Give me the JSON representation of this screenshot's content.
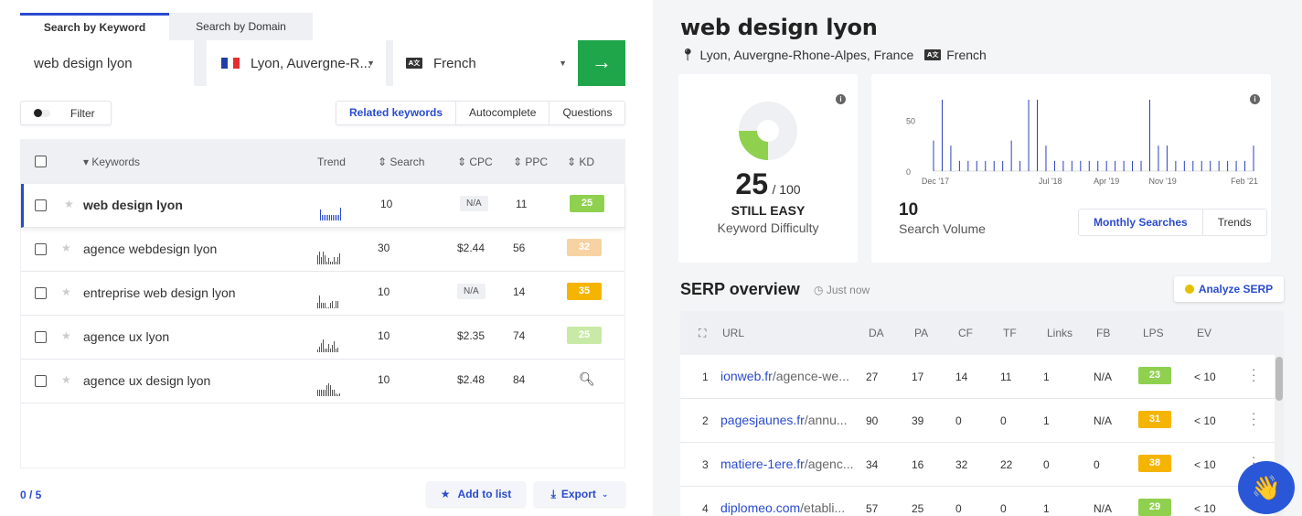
{
  "tabs": [
    {
      "label": "Search by Keyword"
    },
    {
      "label": "Search by Domain"
    }
  ],
  "search": {
    "keyword_value": "web design lyon",
    "location": "Lyon, Auvergne-R...",
    "language": "French",
    "go_icon": "arrow-right-icon"
  },
  "filter_label": "Filter",
  "kw_tabs": [
    {
      "label": "Related keywords"
    },
    {
      "label": "Autocomplete"
    },
    {
      "label": "Questions"
    }
  ],
  "table": {
    "headers": {
      "keywords": "Keywords",
      "trend": "Trend",
      "search": "Search",
      "cpc": "CPC",
      "ppc": "PPC",
      "kd": "KD"
    },
    "rows": [
      {
        "keyword": "web design lyon",
        "search": "10",
        "cpc": "N/A",
        "ppc": "11",
        "kd": "25",
        "kd_color": "#8fd14f"
      },
      {
        "keyword": "agence webdesign lyon",
        "search": "30",
        "cpc": "$2.44",
        "ppc": "56",
        "kd": "32",
        "kd_color": "#f7d3a3"
      },
      {
        "keyword": "entreprise web design lyon",
        "search": "10",
        "cpc": "N/A",
        "ppc": "14",
        "kd": "35",
        "kd_color": "#f5b400"
      },
      {
        "keyword": "agence ux lyon",
        "search": "10",
        "cpc": "$2.35",
        "ppc": "74",
        "kd": "25",
        "kd_color": "#c8eaa6"
      },
      {
        "keyword": "agence ux design lyon",
        "search": "10",
        "cpc": "$2.48",
        "ppc": "84",
        "kd": "",
        "kd_color": ""
      }
    ]
  },
  "footer": {
    "count": "0 / 5",
    "add_to_list": "Add to list",
    "export": "Export"
  },
  "overview": {
    "title": "web design lyon",
    "location": "Lyon, Auvergne-Rhone-Alpes, France",
    "language": "French",
    "kd_score": "25",
    "kd_max": "/ 100",
    "kd_verdict": "STILL EASY",
    "kd_label": "Keyword Difficulty",
    "volume": "10",
    "volume_label": "Search Volume",
    "vol_tabs": [
      {
        "label": "Monthly Searches"
      },
      {
        "label": "Trends"
      }
    ]
  },
  "chart_data": {
    "type": "bar",
    "title": "",
    "categories": [
      "Dec '17",
      "Jul '18",
      "Apr '19",
      "Nov '19",
      "Feb '21"
    ],
    "yticks": [
      "0",
      "50"
    ],
    "ylim": [
      0,
      70
    ],
    "values": [
      30,
      70,
      25,
      10,
      10,
      10,
      10,
      10,
      10,
      30,
      10,
      70,
      70,
      25,
      10,
      10,
      10,
      10,
      10,
      10,
      10,
      10,
      10,
      10,
      10,
      70,
      25,
      25,
      10,
      10,
      10,
      10,
      10,
      10,
      10,
      10,
      10,
      25
    ]
  },
  "serp": {
    "title": "SERP overview",
    "time": "Just now",
    "analyze": "Analyze SERP",
    "headers": {
      "url": "URL",
      "da": "DA",
      "pa": "PA",
      "cf": "CF",
      "tf": "TF",
      "links": "Links",
      "fb": "FB",
      "lps": "LPS",
      "ev": "EV"
    },
    "rows": [
      {
        "n": "1",
        "domain": "ionweb.fr",
        "path": "/agence-we...",
        "da": "27",
        "pa": "17",
        "cf": "14",
        "tf": "11",
        "links": "1",
        "fb": "N/A",
        "lps": "23",
        "lps_color": "#8fd14f",
        "ev": "< 10"
      },
      {
        "n": "2",
        "domain": "pagesjaunes.fr",
        "path": "/annu...",
        "da": "90",
        "pa": "39",
        "cf": "0",
        "tf": "0",
        "links": "1",
        "fb": "N/A",
        "lps": "31",
        "lps_color": "#f5b400",
        "ev": "< 10"
      },
      {
        "n": "3",
        "domain": "matiere-1ere.fr",
        "path": "/agenc...",
        "da": "34",
        "pa": "16",
        "cf": "32",
        "tf": "22",
        "links": "0",
        "fb": "0",
        "lps": "38",
        "lps_color": "#f5b400",
        "ev": "< 10"
      },
      {
        "n": "4",
        "domain": "diplomeo.com",
        "path": "/etabli...",
        "da": "57",
        "pa": "25",
        "cf": "0",
        "tf": "0",
        "links": "1",
        "fb": "N/A",
        "lps": "29",
        "lps_color": "#8fd14f",
        "ev": "< 10"
      }
    ]
  },
  "colors": {
    "accent": "#2a4bcf",
    "go": "#1fa64b"
  }
}
